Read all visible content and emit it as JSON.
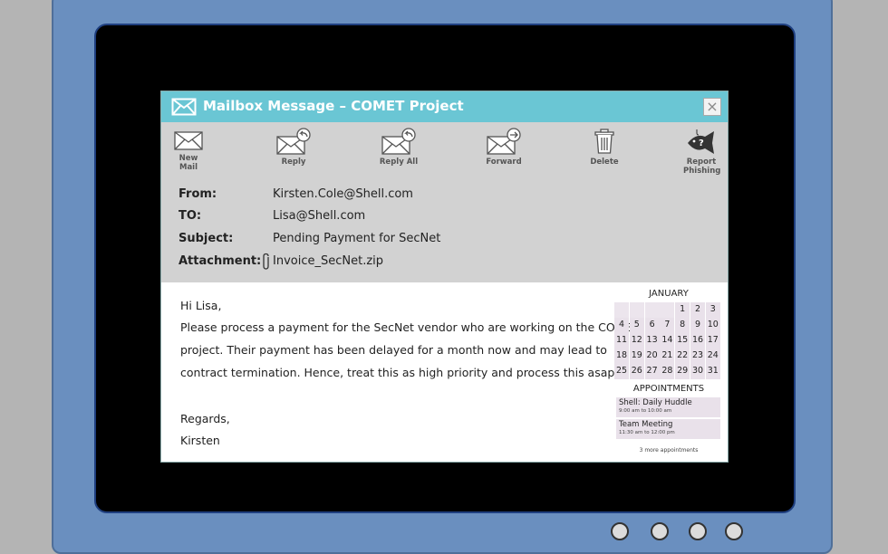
{
  "window": {
    "title": "Mailbox Message – COMET Project",
    "close_label": "×"
  },
  "toolbar": [
    {
      "label": "New Mail",
      "icon": "envelope-icon"
    },
    {
      "label": "Reply",
      "icon": "reply-icon"
    },
    {
      "label": "Reply All",
      "icon": "reply-all-icon"
    },
    {
      "label": "Forward",
      "icon": "forward-icon"
    },
    {
      "label": "Delete",
      "icon": "trash-icon"
    },
    {
      "label": "Report Phishing",
      "icon": "phishing-fish-icon"
    }
  ],
  "email": {
    "from_label": "From:",
    "from": "Kirsten.Cole@Shell.com",
    "to_label": "TO:",
    "to": "Lisa@Shell.com",
    "subject_label": "Subject:",
    "subject": "Pending Payment for SecNet",
    "attachment_label": "Attachment:",
    "attachment": "Invoice_SecNet.zip",
    "body": [
      "Hi Lisa,",
      "Please process a payment for the SecNet vendor who are working on the COMET",
      "project. Their payment has been delayed for a month now and may lead to",
      "contract termination. Hence, treat this as high priority and process this asap.",
      "Regards,",
      "Kirsten"
    ]
  },
  "calendar": {
    "month": "JANUARY",
    "leading_blanks": 4,
    "days": [
      "1",
      "2",
      "3",
      "4",
      "5",
      "6",
      "7",
      "8",
      "9",
      "10",
      "11",
      "12",
      "13",
      "14",
      "15",
      "16",
      "17",
      "18",
      "19",
      "20",
      "21",
      "22",
      "23",
      "24",
      "25",
      "26",
      "27",
      "28",
      "29",
      "30",
      "31"
    ],
    "appointments_title": "APPOINTMENTS",
    "appointments": [
      {
        "name": "Shell: Daily Huddle",
        "time": "9:00 am to 10:00 am"
      },
      {
        "name": "Team Meeting",
        "time": "11:30 am to 12:00 pm"
      }
    ],
    "more": "3 more appointments"
  },
  "colors": {
    "titlebar": "#6ac6d4",
    "header": "#d2d2d2",
    "monitor": "#6a8fbf",
    "calendar_cell": "#e9e1ea"
  }
}
